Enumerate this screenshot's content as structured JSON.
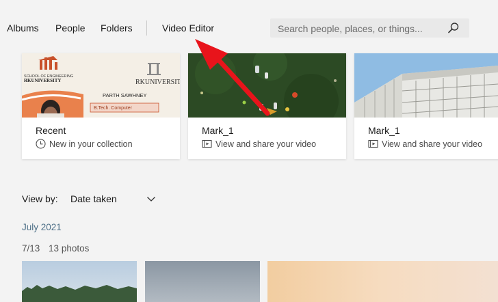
{
  "nav": {
    "albums": "Albums",
    "people": "People",
    "folders": "Folders",
    "video_editor": "Video Editor"
  },
  "search": {
    "placeholder": "Search people, places, or things...",
    "icon": "search-icon"
  },
  "cards": [
    {
      "title": "Recent",
      "subtitle": "New in your collection",
      "icon": "clock-icon"
    },
    {
      "title": "Mark_1",
      "subtitle": "View and share your video",
      "icon": "video-icon"
    },
    {
      "title": "Mark_1",
      "subtitle": "View and share your video",
      "icon": "video-icon"
    }
  ],
  "id_card": {
    "school_top": "SCHOOL OF ENGINEERING",
    "university_left": "RKUNIVERSITY",
    "university_right": "RKUNIVERSITY",
    "name": "PARTH SAWHNEY",
    "course": "B.Tech. Computer"
  },
  "view": {
    "label": "View by:",
    "selected": "Date taken"
  },
  "timeline": {
    "month": "July 2021",
    "date": "7/13",
    "count": "13 photos"
  },
  "colors": {
    "accent_arrow": "#e8141b",
    "month_text": "#4d6f87"
  }
}
